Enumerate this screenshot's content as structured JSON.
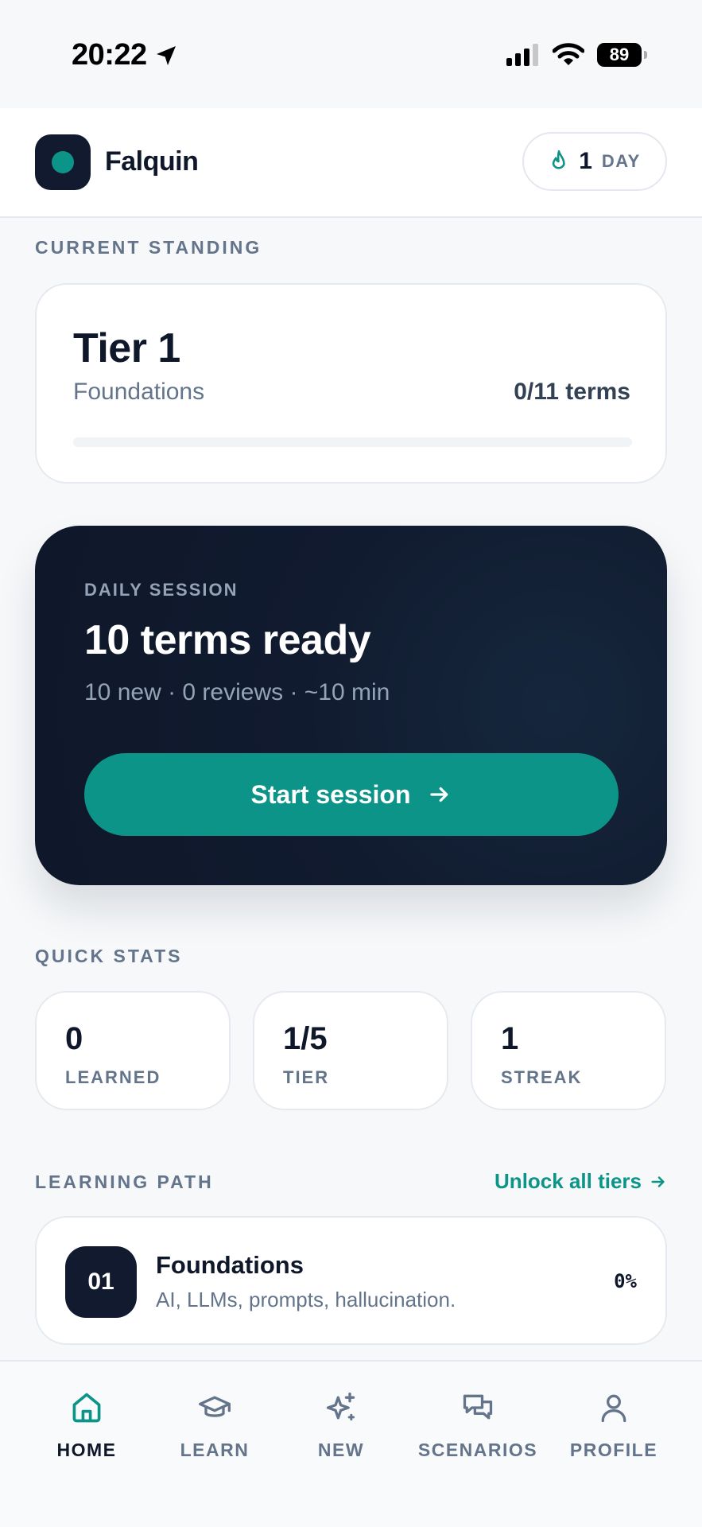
{
  "status_bar": {
    "time": "20:22",
    "battery": "89"
  },
  "header": {
    "app_name": "Falquin",
    "streak_count": "1",
    "streak_unit": "DAY"
  },
  "current_standing": {
    "section_label": "CURRENT STANDING",
    "tier_title": "Tier 1",
    "tier_name": "Foundations",
    "terms_progress": "0/11 terms",
    "progress_fraction": 0
  },
  "daily_session": {
    "label": "DAILY SESSION",
    "title": "10 terms ready",
    "meta": "10 new · 0 reviews · ~10 min",
    "button_label": "Start session"
  },
  "quick_stats": {
    "section_label": "QUICK STATS",
    "items": [
      {
        "value": "0",
        "label": "LEARNED"
      },
      {
        "value": "1/5",
        "label": "TIER"
      },
      {
        "value": "1",
        "label": "STREAK"
      }
    ]
  },
  "learning_path": {
    "section_label": "LEARNING PATH",
    "unlock_label": "Unlock all tiers",
    "items": [
      {
        "number": "01",
        "title": "Foundations",
        "description": "AI, LLMs, prompts, hallucination.",
        "percent": "0%"
      }
    ]
  },
  "nav": {
    "items": [
      {
        "label": "HOME",
        "icon": "home-icon",
        "active": true
      },
      {
        "label": "LEARN",
        "icon": "graduation-cap-icon",
        "active": false
      },
      {
        "label": "NEW",
        "icon": "sparkles-icon",
        "active": false
      },
      {
        "label": "SCENARIOS",
        "icon": "chat-bubbles-icon",
        "active": false
      },
      {
        "label": "PROFILE",
        "icon": "user-icon",
        "active": false
      }
    ]
  },
  "colors": {
    "accent": "#0d9488",
    "dark": "#0f172a",
    "muted": "#64748b",
    "background": "#f6f8fa"
  }
}
